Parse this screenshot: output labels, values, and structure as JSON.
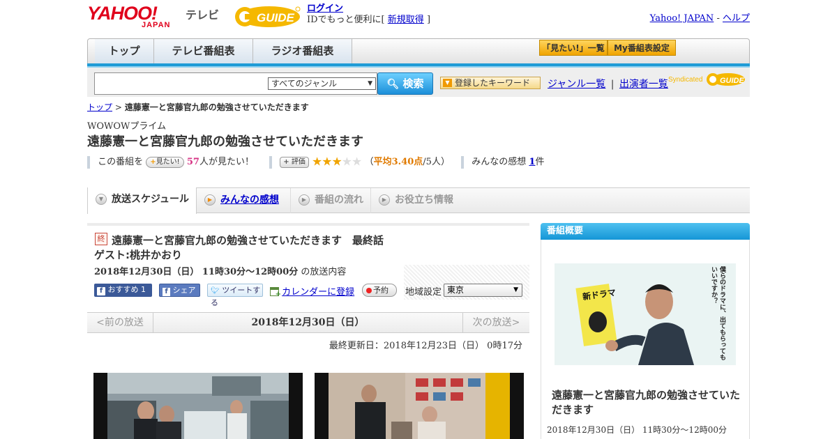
{
  "header": {
    "logo_yahoo": "YAHOO!",
    "logo_japan": "JAPAN",
    "logo_tv": "テレビ",
    "logo_gguide": "G GUIDE",
    "login_label": "ログイン",
    "login_sub_prefix": "IDでもっと便利に[",
    "register_label": "新規取得",
    "login_sub_suffix": "]",
    "yahoo_japan_link": "Yahoo! JAPAN",
    "separator": "-",
    "help_link": "ヘルプ"
  },
  "nav": {
    "tabs": [
      "トップ",
      "テレビ番組表",
      "ラジオ番組表"
    ],
    "mitai_list": "「見たい!」一覧",
    "my_schedule": "My番組表設定"
  },
  "search": {
    "placeholder": "",
    "genre_selected": "すべてのジャンル",
    "search_button": "検索",
    "keyword_button": "登録したキーワード",
    "genre_list_link": "ジャンル一覧",
    "divider": "|",
    "performer_list_link": "出演者一覧",
    "syndicated": "Syndicated"
  },
  "breadcrumb": {
    "home": "トップ",
    "sep": ">",
    "current": "遠藤憲一と宮藤官九郎の勉強させていただきます"
  },
  "program": {
    "channel": "WOWOWプライム",
    "title": "遠藤憲一と宮藤官九郎の勉強させていただきます",
    "this_program": "この番組を",
    "mitai_button": "見たい!",
    "mitai_count": "57",
    "mitai_suffix": "人が見たい！",
    "rate_button": "評価",
    "rating_prefix": "（",
    "rating_avg": "平均3.40点",
    "rating_count": "/5人）",
    "rating_value": 3.4,
    "reviews_prefix": "みんなの感想",
    "reviews_count": "1",
    "reviews_suffix": "件"
  },
  "sub_tabs": [
    "放送スケジュール",
    "みんなの感想",
    "番組の流れ",
    "お役立ち情報"
  ],
  "episode": {
    "badge": "終",
    "title": "遠藤憲一と宮藤官九郎の勉強させていただきます　最終話",
    "guest": "ゲスト:桃井かおり",
    "air_time": "2018年12月30日（日）  11時30分～12時00分",
    "air_suffix": " の放送内容",
    "fb_recommend": "おすすめ 1",
    "fb_share": "シェア",
    "tweet": "ツイートする",
    "calendar": "カレンダーに登録",
    "reserve": "予約",
    "region_label": "地域設定",
    "region_value": "東京"
  },
  "pager": {
    "prev": "<前の放送",
    "current": "2018年12月30日（日）",
    "next": "次の放送>"
  },
  "updated": "最終更新日：2018年12月23日（日）  0時17分",
  "side": {
    "header": "番組概要",
    "poster_text": "僕らのドラマに、出てもらってもいいですか？",
    "poster_sign": "新ドラマ",
    "title": "遠藤憲一と宮藤官九郎の勉強させていただきます",
    "time": "2018年12月30日（日）  11時30分～12時00分"
  },
  "colors": {
    "accent_blue": "#1f9bd6",
    "yahoo_red": "#e0001b",
    "gguide_yellow": "#f5b800",
    "star_orange": "#f0a400"
  }
}
